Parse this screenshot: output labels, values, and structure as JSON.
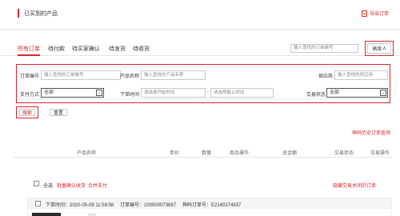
{
  "header": {
    "title": "已买到的产品",
    "export_label": "导出订单"
  },
  "tabs": [
    "所有订单",
    "待付款",
    "待买家确认",
    "待发货",
    "待收货"
  ],
  "top_search": {
    "placeholder": "输入查找的订单编号"
  },
  "advanced_button": {
    "label": "高级",
    "chevron": "∧"
  },
  "filters": {
    "order_no": {
      "label": "订单编号",
      "placeholder": "输入查找的订单编号"
    },
    "product_name": {
      "label": "产品名称",
      "placeholder": "输入查找的产品名称"
    },
    "supplier": {
      "label": "供应商",
      "placeholder": "输入查找的供应商"
    },
    "pay_method": {
      "label": "支付方式",
      "value": "全部"
    },
    "order_time": {
      "label": "下单时间",
      "start_placeholder": "请选择开始时间",
      "separator": "-",
      "end_placeholder": "请选择截止时间"
    },
    "trade_status": {
      "label": "交易状态",
      "value": "全部"
    }
  },
  "actions": {
    "search": "搜索",
    "reset": "重置"
  },
  "history_link": "神码历史订单查询",
  "table_headers": [
    "产品名称",
    "单价",
    "数量",
    "商品操作",
    "总金额",
    "交易状态",
    "交易操作"
  ],
  "bulk": {
    "select_all": "全选",
    "confirm_receipt": "批量确认收货",
    "merge_pay": "合并支付",
    "hide_closed": "隐藏交易关闭的订单"
  },
  "orders": [
    {
      "order_time": "下单时间：2020-05-09 11:59:58",
      "order_no": "订单编号：200500073697",
      "shenma_no": "神码订单号：E2140274937"
    }
  ]
}
